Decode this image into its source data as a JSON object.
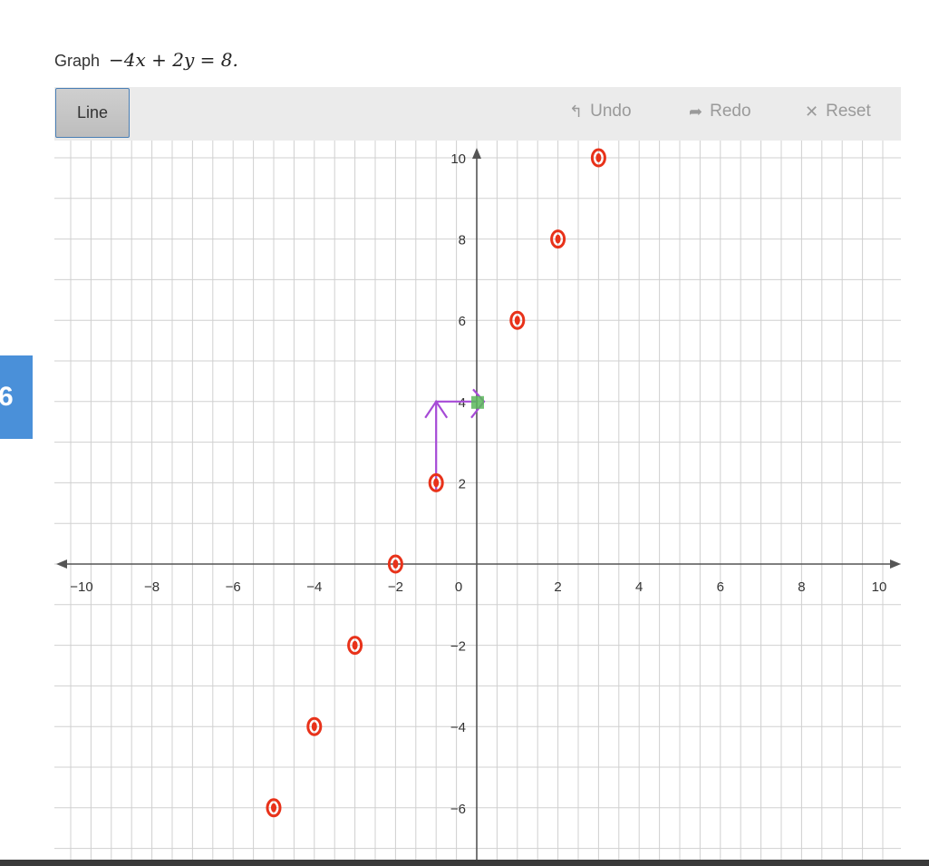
{
  "side_tab": {
    "label": "6"
  },
  "prompt": {
    "label": "Graph",
    "equation": "−4x + 2y = 8."
  },
  "toolbar": {
    "line_label": "Line",
    "undo_label": "Undo",
    "redo_label": "Redo",
    "reset_label": "Reset",
    "undo_icon": "undo-arrow-icon",
    "redo_icon": "redo-arrow-icon",
    "reset_icon": "close-x-icon"
  },
  "graph": {
    "x_range": [
      -10,
      10
    ],
    "y_range": [
      -7.3,
      10.5
    ],
    "x_ticks": [
      "-10",
      "-8",
      "-6",
      "-4",
      "-2",
      "0",
      "2",
      "4",
      "6",
      "8",
      "10"
    ],
    "y_ticks": [
      "10",
      "8",
      "6",
      "4",
      "2",
      "-2",
      "-4",
      "-6"
    ],
    "annotation_color": "#e8321a",
    "slope_color": "#a64ad6",
    "plotted_point_color": "#5cb85c",
    "handwritten_points": [
      {
        "x": 3,
        "y": 10
      },
      {
        "x": 2,
        "y": 8
      },
      {
        "x": 1,
        "y": 6
      },
      {
        "x": -1,
        "y": 2
      },
      {
        "x": -2,
        "y": 0
      },
      {
        "x": -3,
        "y": -2
      },
      {
        "x": -4,
        "y": -4
      },
      {
        "x": -5,
        "y": -6
      }
    ],
    "plotted_point": {
      "x": 0,
      "y": 4
    }
  }
}
